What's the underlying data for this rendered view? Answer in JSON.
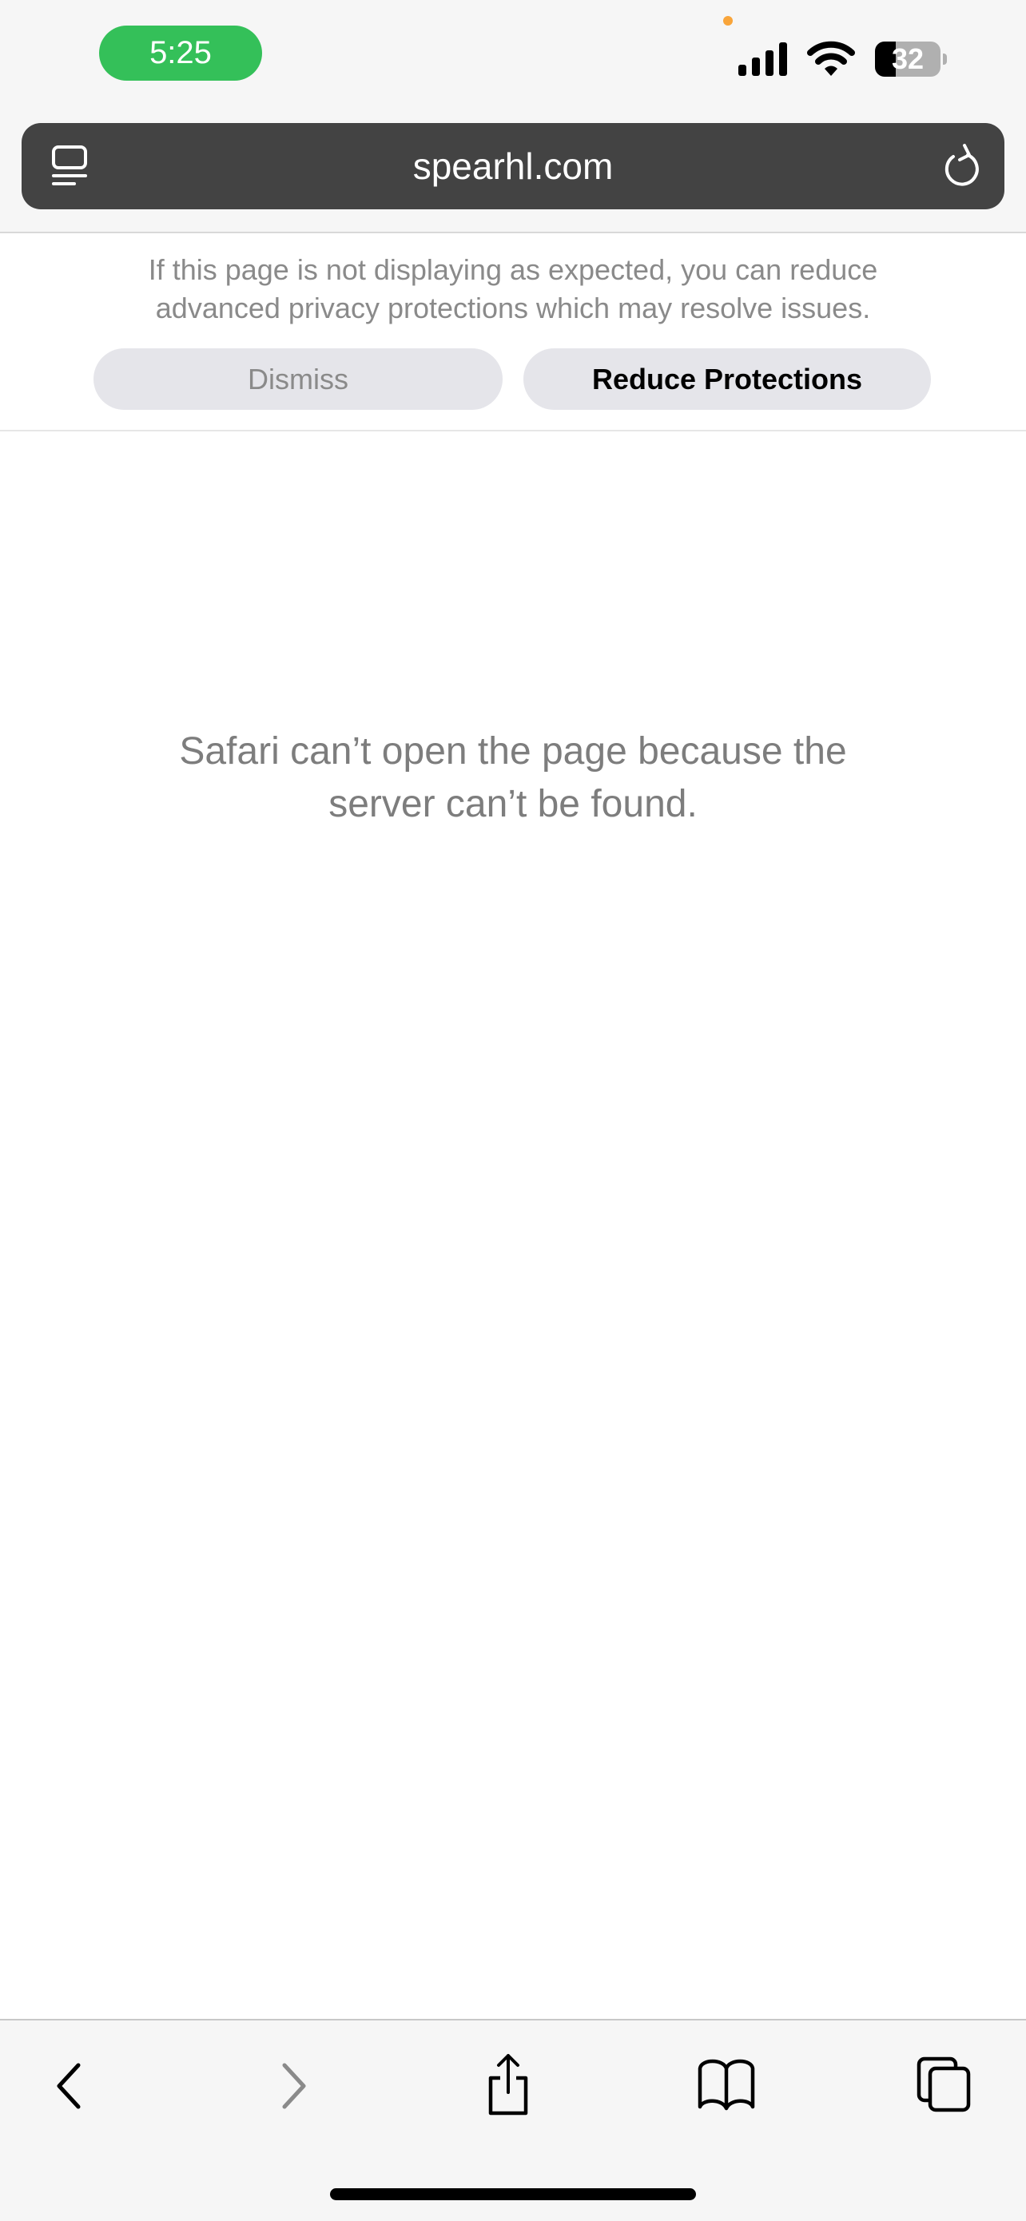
{
  "status_bar": {
    "time": "5:25",
    "battery": "32",
    "battery_level": 0.32,
    "time_pill_color": "#34c059"
  },
  "address_bar": {
    "url": "spearhl.com"
  },
  "privacy_banner": {
    "message": "If this page is not displaying as expected, you can reduce advanced privacy protections which may resolve issues.",
    "dismiss_label": "Dismiss",
    "reduce_label": "Reduce Protections"
  },
  "error": {
    "message_line1": "Safari can’t open the page because the",
    "message_line2": "server can’t be found."
  },
  "toolbar": {
    "icons": [
      "back-icon",
      "forward-icon",
      "share-icon",
      "bookmarks-icon",
      "tabs-icon"
    ]
  }
}
